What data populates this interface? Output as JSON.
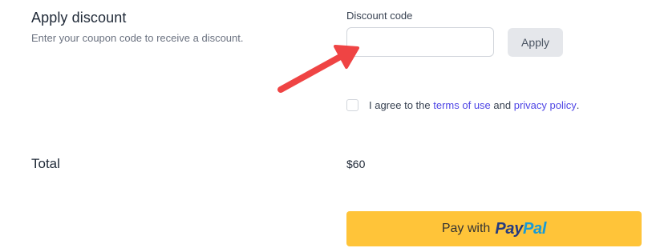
{
  "discount": {
    "title": "Apply discount",
    "description": "Enter your coupon code to receive a discount.",
    "field_label": "Discount code",
    "input_value": "",
    "input_placeholder": "",
    "apply_label": "Apply"
  },
  "agreement": {
    "prefix": "I agree to the",
    "terms_link": "terms of use",
    "conjunction": "and",
    "privacy_link": "privacy policy",
    "suffix": ".",
    "checked": false
  },
  "total": {
    "label": "Total",
    "value": "$60"
  },
  "paypal": {
    "pay_with": "Pay with",
    "logo_pay": "Pay",
    "logo_pal": "Pal"
  },
  "colors": {
    "accent_link": "#4f46e5",
    "paypal_button": "#ffc439",
    "arrow": "#ef4444"
  },
  "annotation": {
    "arrow_icon": "red-arrow-icon"
  }
}
